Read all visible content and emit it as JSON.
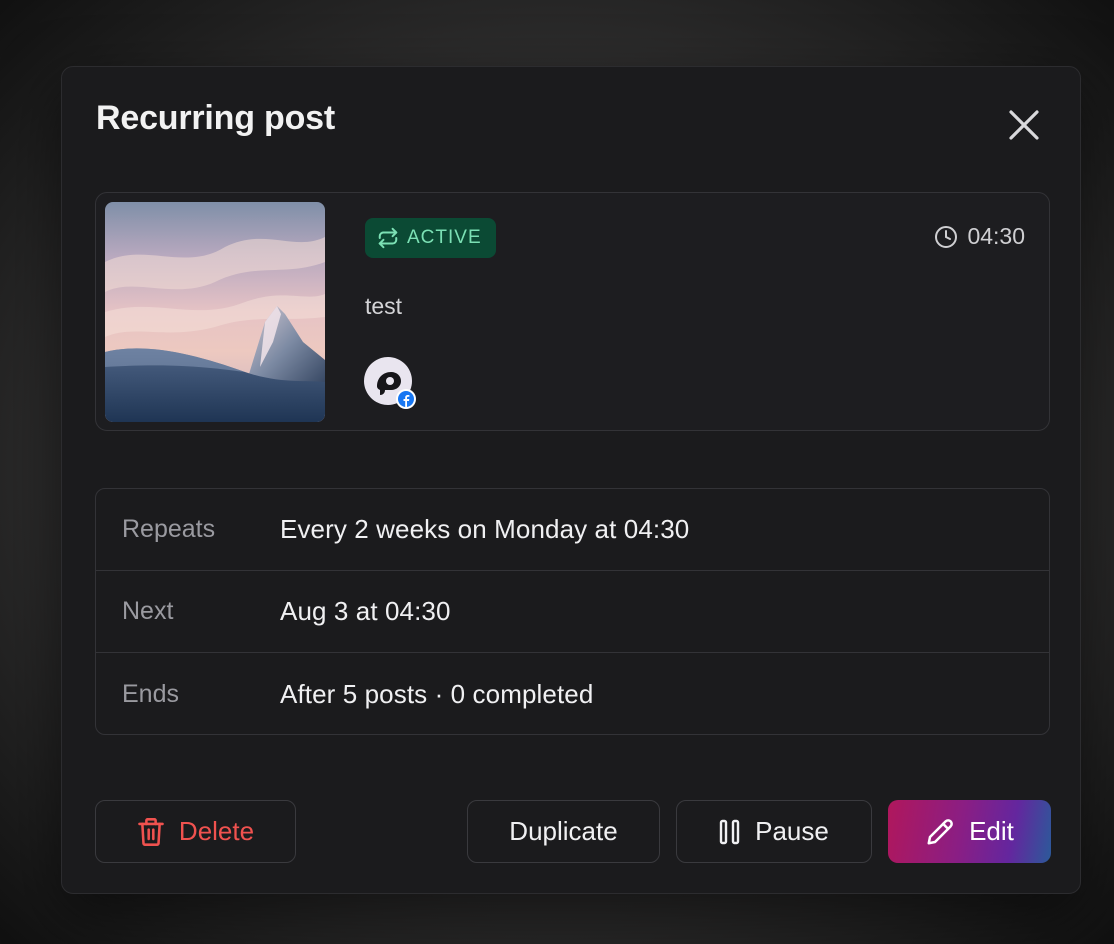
{
  "modal": {
    "title": "Recurring post",
    "close_icon": "close-icon"
  },
  "post": {
    "status_label": "ACTIVE",
    "status_icon": "repeat-icon",
    "time": "04:30",
    "time_icon": "clock-icon",
    "text": "test",
    "network_icon": "facebook-icon",
    "colors": {
      "badge_bg": "#0b4a34",
      "badge_text": "#7be0b4"
    }
  },
  "details": [
    {
      "label": "Repeats",
      "value": "Every 2 weeks on Monday at 04:30"
    },
    {
      "label": "Next",
      "value": "Aug 3 at 04:30"
    },
    {
      "label": "Ends",
      "value": "After 5 posts · 0 completed"
    }
  ],
  "actions": {
    "delete_label": "Delete",
    "duplicate_label": "Duplicate",
    "pause_label": "Pause",
    "edit_label": "Edit",
    "colors": {
      "delete": "#f0524f",
      "edit_gradient_start": "#b0175c",
      "edit_gradient_end": "#2b5a9a"
    }
  }
}
